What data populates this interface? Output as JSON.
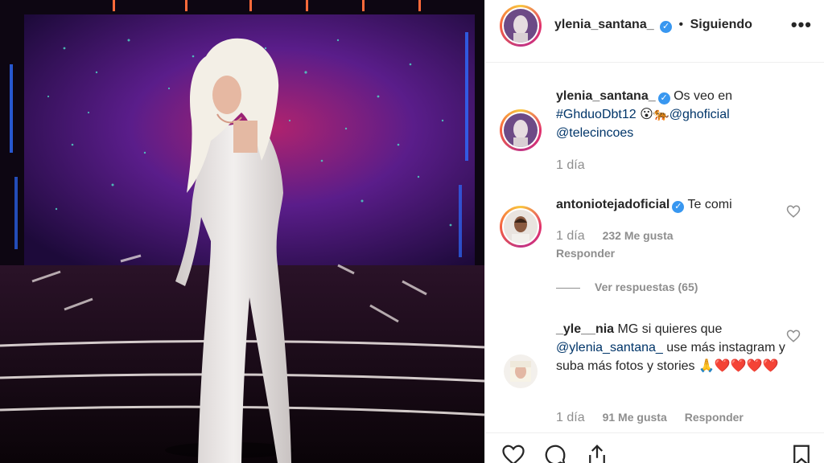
{
  "post": {
    "author": "ylenia_santana_",
    "separator": "•",
    "follow_status": "Siguiendo",
    "more_label": "•••"
  },
  "caption": {
    "user": "ylenia_santana_",
    "text_before": "Os veo en",
    "hashtag": "#GhduoDbt12",
    "emojis": "😮🐅",
    "mention1": "@ghoficial",
    "mention2": "@telecincoes",
    "time": "1 día"
  },
  "comments": [
    {
      "user": "antoniotejadoficial",
      "text": "Te comi",
      "time": "1 día",
      "likes": "232 Me gusta",
      "reply": "Responder",
      "view_replies": "Ver respuestas (65)"
    },
    {
      "user": "_yle__nia",
      "text_before": "MG si quieres que",
      "mention": "@ylenia_santana_",
      "text_after": "use más instagram y suba más fotos y stories",
      "emojis": "🙏❤️❤️❤️❤️",
      "time": "1 día",
      "likes": "91 Me gusta",
      "reply": "Responder"
    }
  ],
  "icons": {
    "like": "heart-icon",
    "comment": "comment-icon",
    "share": "share-icon",
    "save": "bookmark-icon",
    "verified": "verified-icon"
  },
  "colors": {
    "link": "#003569",
    "verified": "#3897f0",
    "muted": "#8e8e8e",
    "text": "#262626"
  }
}
